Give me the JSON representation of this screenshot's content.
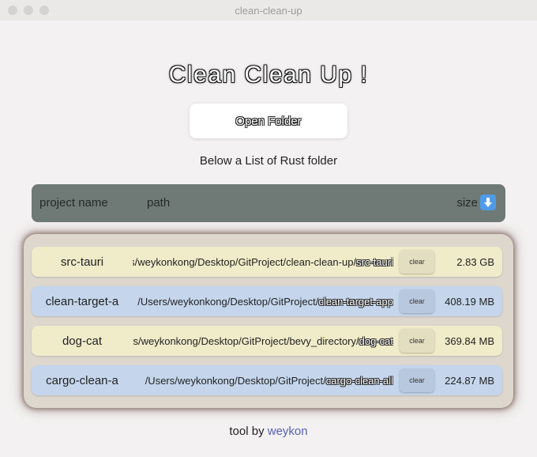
{
  "window": {
    "title": "clean-clean-up"
  },
  "app": {
    "title": "Clean Clean Up !",
    "open_button": "Open Folder",
    "subtitle": "Below a List of Rust folder"
  },
  "table": {
    "headers": {
      "name": "project name",
      "path": "path",
      "size": "size"
    },
    "sort_icon": "arrow-down-icon",
    "rows": [
      {
        "name": "src-tauri",
        "path_prefix": "rs/weykonkong/Desktop/GitProject/clean-clean-up/",
        "path_tail": "src-tauri",
        "clear": "clear",
        "size": "2.83 GB",
        "color": "#f0ebc9"
      },
      {
        "name": "clean-target-a",
        "path_prefix": "/Users/weykonkong/Desktop/GitProject/",
        "path_tail": "clean-target-app",
        "clear": "clear",
        "size": "408.19 MB",
        "color": "#c5d6ec"
      },
      {
        "name": "dog-cat",
        "path_prefix": "rs/weykonkong/Desktop/GitProject/bevy_directory/",
        "path_tail": "dog-cat",
        "clear": "clear",
        "size": "369.84 MB",
        "color": "#f0ebc9"
      },
      {
        "name": "cargo-clean-a",
        "path_prefix": "/Users/weykonkong/Desktop/GitProject/",
        "path_tail": "cargo-clean-all",
        "clear": "clear",
        "size": "224.87 MB",
        "color": "#c5d6ec"
      }
    ]
  },
  "footer": {
    "text": "tool by",
    "link": "weykon"
  },
  "colors": {
    "header_bar": "#6f7a76",
    "panel": "#ddd7ce",
    "accent_link": "#5661b3"
  }
}
